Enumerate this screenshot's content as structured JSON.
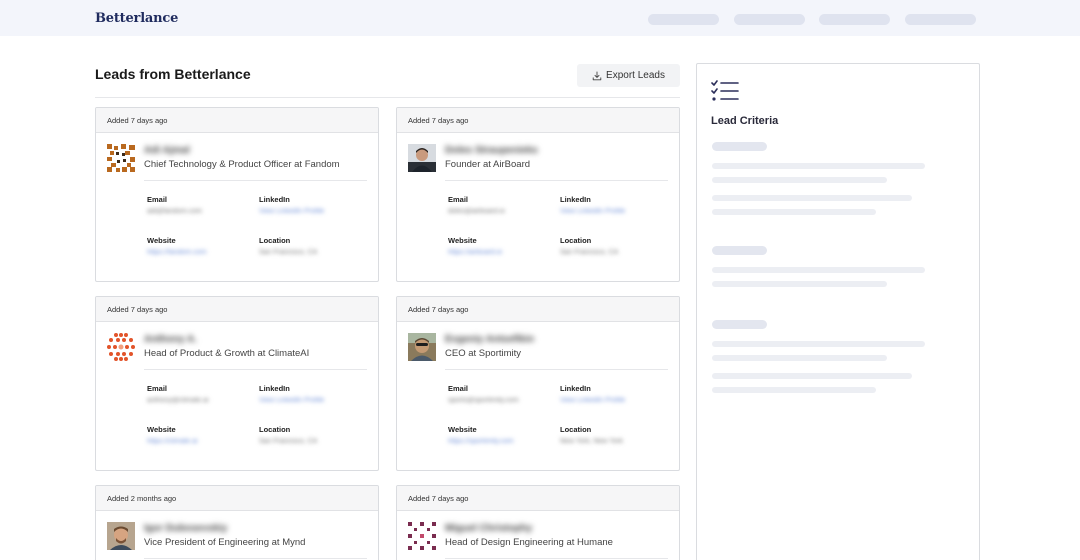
{
  "header": {
    "brand": "Betterlance",
    "nav_placeholder_count": 4
  },
  "main": {
    "title": "Leads from Betterlance",
    "export_label": "Export Leads"
  },
  "field_labels": {
    "email": "Email",
    "linkedin": "LinkedIn",
    "website": "Website",
    "location": "Location"
  },
  "leads": [
    {
      "added": "Added 7 days ago",
      "name": "Adi Ajmal",
      "title": "Chief Technology & Product Officer at Fandom",
      "email": "adi@fandom.com",
      "linkedin": "View LinkedIn Profile",
      "website": "https://fandom.com",
      "location": "San Francisco, CA",
      "avatar": "orange-pattern-avatar"
    },
    {
      "added": "Added 7 days ago",
      "name": "Doles Straupenieks",
      "title": "Founder at AirBoard",
      "email": "doles@airboard.io",
      "linkedin": "View LinkedIn Profile",
      "website": "https://airboard.io",
      "location": "San Francisco, CA",
      "avatar": "photo-avatar"
    },
    {
      "added": "Added 7 days ago",
      "name": "Anthony A.",
      "title": "Head of Product & Growth at ClimateAI",
      "email": "anthony@climate.ai",
      "linkedin": "View LinkedIn Profile",
      "website": "https://climate.ai",
      "location": "San Francisco, CA",
      "avatar": "red-pattern-avatar"
    },
    {
      "added": "Added 7 days ago",
      "name": "Evgeniy Antsefikin",
      "title": "CEO at Sportimity",
      "email": "sports@sportimity.com",
      "linkedin": "View LinkedIn Profile",
      "website": "https://sportimity.com",
      "location": "New York, New York",
      "avatar": "photo-avatar"
    },
    {
      "added": "Added 2 months ago",
      "name": "Igor Dubosevskiy",
      "title": "Vice President of Engineering at Mynd",
      "email": "",
      "linkedin": "",
      "website": "",
      "location": "",
      "avatar": "photo-avatar"
    },
    {
      "added": "Added 7 days ago",
      "name": "Miguel Christophy",
      "title": "Head of Design Engineering at Humane",
      "email": "",
      "linkedin": "",
      "website": "",
      "location": "",
      "avatar": "purple-pattern-avatar"
    }
  ],
  "criteria": {
    "title": "Lead Criteria",
    "icon": "checklist-icon"
  },
  "colors": {
    "brand": "#1f2b5e",
    "header_bg": "#f3f5fb",
    "card_border": "#dadce0",
    "link": "#6e8fd8"
  }
}
